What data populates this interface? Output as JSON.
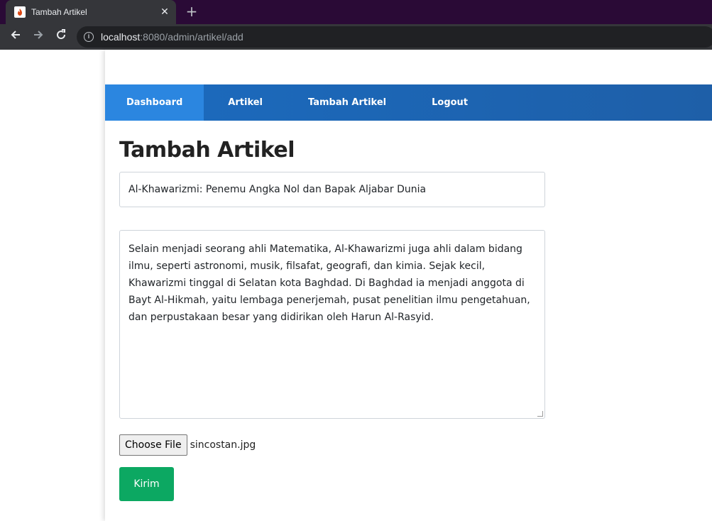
{
  "browser": {
    "tab_title": "Tambah Artikel",
    "close_glyph": "✕",
    "newtab_glyph": "+",
    "url_host": "localhost",
    "url_path": ":8080/admin/artikel/add",
    "info_glyph": "i"
  },
  "nav": {
    "items": [
      "Dashboard",
      "Artikel",
      "Tambah Artikel",
      "Logout"
    ],
    "active_index": 0
  },
  "page": {
    "title": "Tambah Artikel"
  },
  "form": {
    "title_value": "Al-Khawarizmi: Penemu Angka Nol dan Bapak Aljabar Dunia",
    "content_value": "Selain menjadi seorang ahli Matematika, Al-Khawarizmi juga ahli dalam bidang ilmu, seperti astronomi, musik, filsafat, geografi, dan kimia. Sejak kecil, Khawarizmi tinggal di Selatan kota Baghdad. Di Baghdad ia menjadi anggota di Bayt Al-Hikmah, yaitu lembaga penerjemah, pusat penelitian ilmu pengetahuan, dan perpustakaan besar yang didirikan oleh Harun Al-Rasyid.",
    "file_button_label": "Choose File",
    "file_name": "sincostan.jpg",
    "submit_label": "Kirim"
  },
  "colors": {
    "navbar": "#1b6bbf",
    "nav_active": "#2b86e0",
    "submit": "#0ca862",
    "tabstrip": "#2a0a36"
  }
}
